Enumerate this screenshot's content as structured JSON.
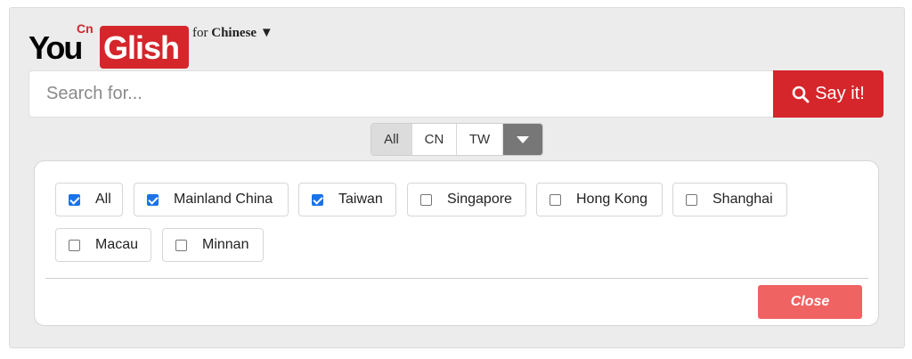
{
  "logo": {
    "you": "You",
    "glish": "Glish",
    "badge": "Cn"
  },
  "language_selector": {
    "prefix": "for",
    "language": "Chinese",
    "arrow": "▼"
  },
  "search": {
    "placeholder": "Search for...",
    "button_label": "Say it!",
    "button_icon": "search-icon"
  },
  "accent_tabs": {
    "items": [
      {
        "label": "All",
        "active": true
      },
      {
        "label": "CN",
        "active": false
      },
      {
        "label": "TW",
        "active": false
      }
    ],
    "dropdown_icon": "caret-down-icon"
  },
  "region_dialog": {
    "options": [
      {
        "label": "All",
        "checked": true
      },
      {
        "label": "Mainland China",
        "checked": true
      },
      {
        "label": "Taiwan",
        "checked": true
      },
      {
        "label": "Singapore",
        "checked": false
      },
      {
        "label": "Hong Kong",
        "checked": false
      },
      {
        "label": "Shanghai",
        "checked": false
      },
      {
        "label": "Macau",
        "checked": false
      },
      {
        "label": "Minnan",
        "checked": false
      }
    ],
    "close_label": "Close"
  },
  "colors": {
    "brand_red": "#d5262b",
    "close_button": "#ef6362",
    "checkbox_checked": "#1a73e8",
    "dropdown_bg": "#777777",
    "panel_bg": "#ececec"
  }
}
